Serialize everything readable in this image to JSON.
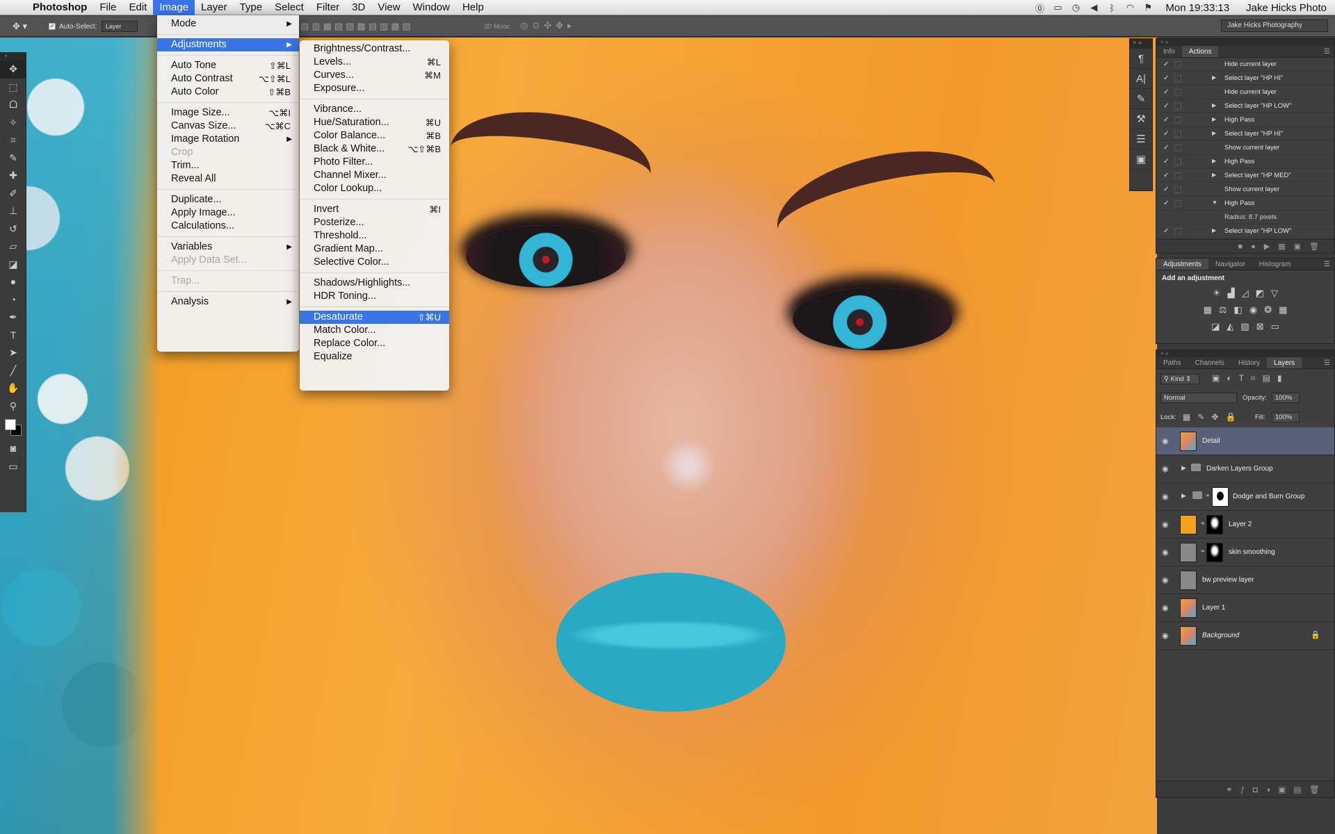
{
  "menubar": {
    "app": "Photoshop",
    "items": [
      "File",
      "Edit",
      "Image",
      "Layer",
      "Type",
      "Select",
      "Filter",
      "3D",
      "View",
      "Window",
      "Help"
    ],
    "clock": "Mon 19:33:13",
    "user": "Jake Hicks Photo"
  },
  "options_bar": {
    "auto_select_label": "Auto-Select:",
    "auto_select_checked": "✓",
    "auto_select_value": "Layer",
    "mode_3d_label": "3D Mode:",
    "workspace": "Jake Hicks Photography"
  },
  "image_menu": {
    "mode": "Mode",
    "adjustments": "Adjustments",
    "auto_tone": {
      "label": "Auto Tone",
      "shortcut": "⇧⌘L"
    },
    "auto_contrast": {
      "label": "Auto Contrast",
      "shortcut": "⌥⇧⌘L"
    },
    "auto_color": {
      "label": "Auto Color",
      "shortcut": "⇧⌘B"
    },
    "image_size": {
      "label": "Image Size...",
      "shortcut": "⌥⌘I"
    },
    "canvas_size": {
      "label": "Canvas Size...",
      "shortcut": "⌥⌘C"
    },
    "image_rotation": "Image Rotation",
    "crop": "Crop",
    "trim": "Trim...",
    "reveal_all": "Reveal All",
    "duplicate": "Duplicate...",
    "apply_image": "Apply Image...",
    "calculations": "Calculations...",
    "variables": "Variables",
    "apply_data_set": "Apply Data Set...",
    "trap": "Trap...",
    "analysis": "Analysis"
  },
  "adjustments_menu": {
    "brightness_contrast": "Brightness/Contrast...",
    "levels": {
      "label": "Levels...",
      "shortcut": "⌘L"
    },
    "curves": {
      "label": "Curves...",
      "shortcut": "⌘M"
    },
    "exposure": "Exposure...",
    "vibrance": "Vibrance...",
    "hue_saturation": {
      "label": "Hue/Saturation...",
      "shortcut": "⌘U"
    },
    "color_balance": {
      "label": "Color Balance...",
      "shortcut": "⌘B"
    },
    "black_white": {
      "label": "Black & White...",
      "shortcut": "⌥⇧⌘B"
    },
    "photo_filter": "Photo Filter...",
    "channel_mixer": "Channel Mixer...",
    "color_lookup": "Color Lookup...",
    "invert": {
      "label": "Invert",
      "shortcut": "⌘I"
    },
    "posterize": "Posterize...",
    "threshold": "Threshold...",
    "gradient_map": "Gradient Map...",
    "selective_color": "Selective Color...",
    "shadows_highlights": "Shadows/Highlights...",
    "hdr_toning": "HDR Toning...",
    "desaturate": {
      "label": "Desaturate",
      "shortcut": "⇧⌘U"
    },
    "match_color": "Match Color...",
    "replace_color": "Replace Color...",
    "equalize": "Equalize"
  },
  "actions_panel": {
    "tabs": [
      "Info",
      "Actions"
    ],
    "rows": [
      {
        "label": "Hide current layer",
        "expand": ""
      },
      {
        "label": "Select layer \"HP HI\"",
        "expand": "▶"
      },
      {
        "label": "Hide current layer",
        "expand": ""
      },
      {
        "label": "Select layer \"HP LOW\"",
        "expand": "▶"
      },
      {
        "label": "High Pass",
        "expand": "▶"
      },
      {
        "label": "Select layer \"HP HI\"",
        "expand": "▶"
      },
      {
        "label": "Show current layer",
        "expand": ""
      },
      {
        "label": "High Pass",
        "expand": "▶"
      },
      {
        "label": "Select layer \"HP MED\"",
        "expand": "▶"
      },
      {
        "label": "Show current layer",
        "expand": ""
      },
      {
        "label": "High Pass",
        "expand": "▼"
      },
      {
        "label": "Radius: 8.7 pixels",
        "expand": ""
      },
      {
        "label": "Select layer \"HP LOW\"",
        "expand": "▶"
      }
    ]
  },
  "adjustments_panel": {
    "tabs": [
      "Adjustments",
      "Navigator",
      "Histogram"
    ],
    "title": "Add an adjustment"
  },
  "layers_panel": {
    "tabs": [
      "Paths",
      "Channels",
      "History",
      "Layers"
    ],
    "kind": "Kind",
    "blend_mode": "Normal",
    "opacity_label": "Opacity:",
    "opacity": "100%",
    "lock_label": "Lock:",
    "fill_label": "Fill:",
    "fill": "100%",
    "layers": [
      {
        "name": "Detail",
        "type": "layer",
        "selected": true
      },
      {
        "name": "Darken Layers Group",
        "type": "group"
      },
      {
        "name": "Dodge and Burn Group",
        "type": "group-mask"
      },
      {
        "name": "Layer 2",
        "type": "fill-mask",
        "thumb_color": "#f5a21e"
      },
      {
        "name": "skin smoothing",
        "type": "fill-mask",
        "thumb_color": "#888888"
      },
      {
        "name": "bw preview layer",
        "type": "plain",
        "thumb_color": "#8a8a8a"
      },
      {
        "name": "Layer 1",
        "type": "layer"
      },
      {
        "name": "Background",
        "type": "background",
        "locked": true
      }
    ]
  },
  "colors": {
    "menu_highlight": "#3a74e8",
    "selected_layer": "#596179",
    "panel_bg": "#3f3f3f"
  }
}
